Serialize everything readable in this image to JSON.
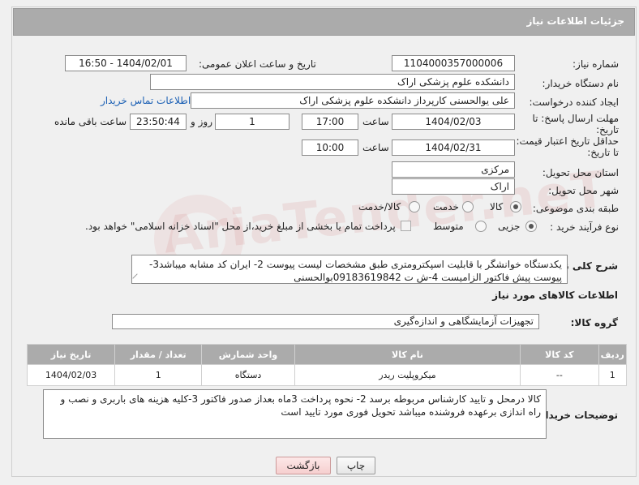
{
  "header": {
    "title": "جزئیات اطلاعات نیاز"
  },
  "form": {
    "need_number": {
      "label": "شماره نیاز:",
      "value": "1104000357000006"
    },
    "announce_datetime": {
      "label": "تاریخ و ساعت اعلان عمومی:",
      "value": "1404/02/01 - 16:50"
    },
    "buyer_org": {
      "label": "نام دستگاه خریدار:",
      "value": "دانشکده علوم پزشکی اراک"
    },
    "requester": {
      "label": "ایجاد کننده درخواست:",
      "value": "علی یوالحسنی کارپرداز دانشکده علوم پزشکی اراک",
      "contact_link": "اطلاعات تماس خریدار"
    },
    "reply_deadline": {
      "label_line1": "مهلت ارسال پاسخ: تا",
      "label_line2": "تاریخ:",
      "date": "1404/02/03",
      "time_label": "ساعت",
      "time": "17:00",
      "days": "1",
      "days_label": "روز و",
      "remaining": "23:50:44",
      "remaining_label": "ساعت باقی مانده"
    },
    "price_validity": {
      "label_line1": "حداقل تاریخ اعتبار قیمت:",
      "label_line2": "تا تاریخ:",
      "date": "1404/02/31",
      "time_label": "ساعت",
      "time": "10:00"
    },
    "delivery_province": {
      "label": "استان محل تحویل:",
      "value": "مرکزی"
    },
    "delivery_city": {
      "label": "شهر محل تحویل:",
      "value": "اراک"
    },
    "category": {
      "label": "طبقه بندی موضوعی:",
      "options": [
        "کالا",
        "خدمت",
        "کالا/خدمت"
      ],
      "selected": "کالا"
    },
    "purchase_process": {
      "label": "نوع فرآیند خرید :",
      "options": [
        "جزیی",
        "متوسط"
      ],
      "selected": "جزیی",
      "treasury_note": "پرداخت تمام یا بخشی از مبلغ خرید،از محل \"اسناد خزانه اسلامی\" خواهد بود."
    },
    "summary": {
      "label": "شرح کلی نیاز:",
      "value": "یکدستگاه خوانشگر با قابلیت اسپکترومتری طبق مشخصات لیست پیوست 2- ایران کد مشابه میباشد3- پیوست پیش فاکتور الزامیست 4-ش ت 09183619842بوالحسنی"
    },
    "goods_info_title": "اطلاعات کالاهای مورد نیاز",
    "goods_group": {
      "label": "گروه کالا:",
      "value": "تجهیزات آزمایشگاهی و اندازه‌گیری"
    }
  },
  "items_table": {
    "headers": [
      "ردیف",
      "کد کالا",
      "نام کالا",
      "واحد شمارش",
      "تعداد / مقدار",
      "تاریخ نیاز"
    ],
    "rows": [
      [
        "1",
        "--",
        "میکروپلیت ریدر",
        "دستگاه",
        "1",
        "1404/02/03"
      ]
    ]
  },
  "buyer_notes": {
    "label": "توضیحات خریدار:",
    "value": "کالا درمحل و تایید کارشناس مربوطه برسد 2- نحوه پرداخت 3ماه بعداز صدور فاکتور 3-کلیه هزینه های باربری و نصب و راه اندازی برعهده فروشنده میباشد  تحویل فوری مورد تایید است"
  },
  "buttons": {
    "print": "چاپ",
    "back": "بازگشت"
  },
  "watermark": "AriaTender.neT"
}
